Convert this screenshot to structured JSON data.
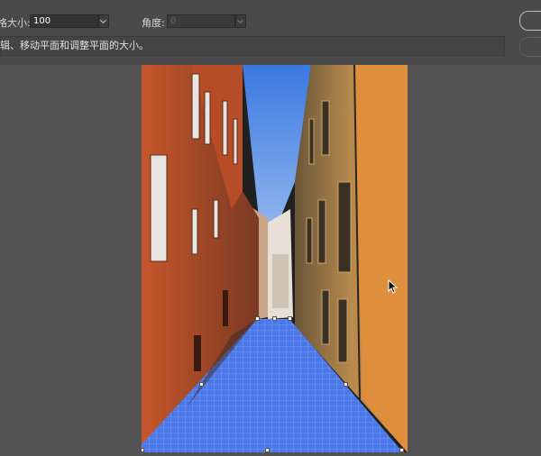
{
  "toolbar": {
    "grid_size_label": "网格大小:",
    "grid_size_value": "100",
    "angle_label": "角度:",
    "angle_value": "0"
  },
  "hint": {
    "text": "编辑、移动平面和调整平面的大小。"
  },
  "colors": {
    "toolbar_bg": "#4a4a4a",
    "workspace_bg": "#535353",
    "plane_grid": "#4a78e8",
    "sky": "#3f7fe0",
    "left_wall": "#c2522a",
    "right_wall": "#d98a3a"
  },
  "icons": {
    "cursor": "arrow-cursor-icon",
    "grid_dropdown": "chevron-down-icon",
    "angle_dropdown": "chevron-down-icon"
  }
}
